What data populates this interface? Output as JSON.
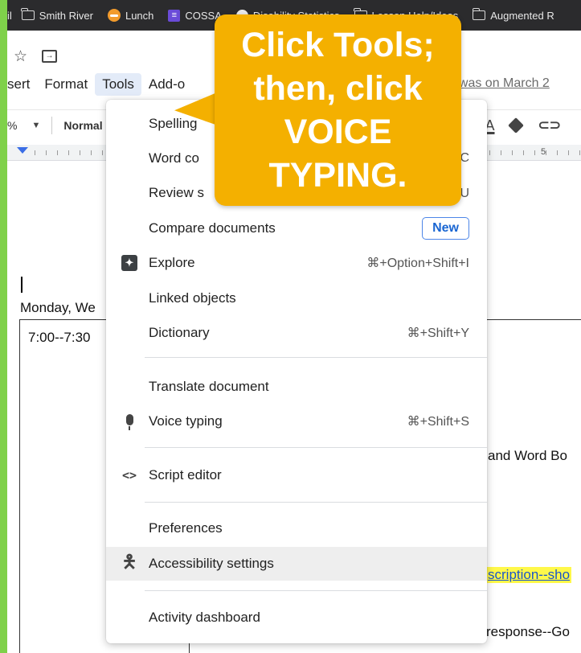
{
  "bookmarks": [
    {
      "label": "il",
      "icon": "none"
    },
    {
      "label": "Smith River",
      "icon": "folder-icon"
    },
    {
      "label": "Lunch",
      "icon": "lunch-icon"
    },
    {
      "label": "COSSA",
      "icon": "list-icon"
    },
    {
      "label": "Disability Statistics",
      "icon": "circle-icon"
    },
    {
      "label": "Lesson Help/Ideas",
      "icon": "folder-icon"
    },
    {
      "label": "Augmented R",
      "icon": "folder-icon"
    }
  ],
  "menubar": {
    "items": [
      "sert",
      "Format",
      "Tools",
      "Add-o"
    ],
    "last_edit": "t was on March 2"
  },
  "toolbar": {
    "zoom": "%",
    "style": "Normal",
    "text_color_glyph": "A"
  },
  "ruler": {
    "number": "5"
  },
  "document": {
    "date_heading": "Monday, We",
    "time_cell": "7:00--7:30",
    "text1": "and Word Bo",
    "link_text": "scription--sho",
    "text2": "response--Go"
  },
  "tools_menu": {
    "items": [
      {
        "label": "Spelling",
        "shortcut": "",
        "icon": ""
      },
      {
        "label": "Word co",
        "shortcut": "+C",
        "icon": ""
      },
      {
        "label": "Review s",
        "shortcut": "⌘U",
        "icon": ""
      },
      {
        "label": "Compare documents",
        "badge": "New",
        "icon": ""
      },
      {
        "label": "Explore",
        "shortcut": "⌘+Option+Shift+I",
        "icon": "explore-icon"
      },
      {
        "label": "Linked objects",
        "shortcut": "",
        "icon": ""
      },
      {
        "label": "Dictionary",
        "shortcut": "⌘+Shift+Y",
        "icon": ""
      },
      {
        "label": "Translate document",
        "shortcut": "",
        "icon": ""
      },
      {
        "label": "Voice typing",
        "shortcut": "⌘+Shift+S",
        "icon": "microphone-icon"
      },
      {
        "label": "Script editor",
        "shortcut": "",
        "icon": "code-icon"
      },
      {
        "label": "Preferences",
        "shortcut": "",
        "icon": ""
      },
      {
        "label": "Accessibility settings",
        "shortcut": "",
        "icon": "accessibility-icon"
      },
      {
        "label": "Activity dashboard",
        "shortcut": "",
        "icon": ""
      }
    ]
  },
  "callout": {
    "text": "Click Tools; then, click VOICE TYPING.",
    "color": "#f4b000"
  },
  "colors": {
    "border_green": "#7fd14a",
    "menu_active": "#e3ebf8",
    "new_badge": "#1a66d2",
    "link_highlight": "#fff84a"
  }
}
